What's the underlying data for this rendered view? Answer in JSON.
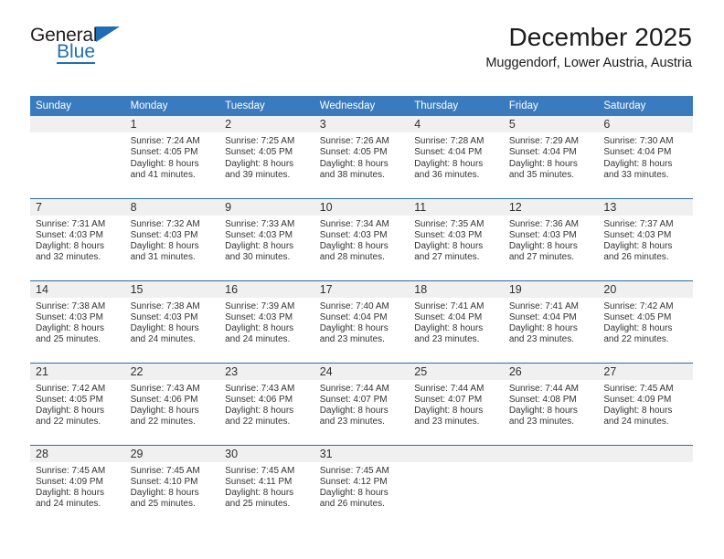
{
  "brand": {
    "name_part1": "General",
    "name_part2": "Blue",
    "triangle_color": "#1f6eb5"
  },
  "header": {
    "title": "December 2025",
    "subtitle": "Muggendorf, Lower Austria, Austria"
  },
  "colors": {
    "header_bar": "#3a7bbf",
    "row_divider": "#2e6da4",
    "daynum_band": "#f0f0f0",
    "brand_blue": "#1f6eb5"
  },
  "calendar": {
    "weekday_headers": [
      "Sunday",
      "Monday",
      "Tuesday",
      "Wednesday",
      "Thursday",
      "Friday",
      "Saturday"
    ],
    "weeks": [
      [
        {
          "day": "",
          "lines": []
        },
        {
          "day": "1",
          "lines": [
            "Sunrise: 7:24 AM",
            "Sunset: 4:05 PM",
            "Daylight: 8 hours",
            "and 41 minutes."
          ]
        },
        {
          "day": "2",
          "lines": [
            "Sunrise: 7:25 AM",
            "Sunset: 4:05 PM",
            "Daylight: 8 hours",
            "and 39 minutes."
          ]
        },
        {
          "day": "3",
          "lines": [
            "Sunrise: 7:26 AM",
            "Sunset: 4:05 PM",
            "Daylight: 8 hours",
            "and 38 minutes."
          ]
        },
        {
          "day": "4",
          "lines": [
            "Sunrise: 7:28 AM",
            "Sunset: 4:04 PM",
            "Daylight: 8 hours",
            "and 36 minutes."
          ]
        },
        {
          "day": "5",
          "lines": [
            "Sunrise: 7:29 AM",
            "Sunset: 4:04 PM",
            "Daylight: 8 hours",
            "and 35 minutes."
          ]
        },
        {
          "day": "6",
          "lines": [
            "Sunrise: 7:30 AM",
            "Sunset: 4:04 PM",
            "Daylight: 8 hours",
            "and 33 minutes."
          ]
        }
      ],
      [
        {
          "day": "7",
          "lines": [
            "Sunrise: 7:31 AM",
            "Sunset: 4:03 PM",
            "Daylight: 8 hours",
            "and 32 minutes."
          ]
        },
        {
          "day": "8",
          "lines": [
            "Sunrise: 7:32 AM",
            "Sunset: 4:03 PM",
            "Daylight: 8 hours",
            "and 31 minutes."
          ]
        },
        {
          "day": "9",
          "lines": [
            "Sunrise: 7:33 AM",
            "Sunset: 4:03 PM",
            "Daylight: 8 hours",
            "and 30 minutes."
          ]
        },
        {
          "day": "10",
          "lines": [
            "Sunrise: 7:34 AM",
            "Sunset: 4:03 PM",
            "Daylight: 8 hours",
            "and 28 minutes."
          ]
        },
        {
          "day": "11",
          "lines": [
            "Sunrise: 7:35 AM",
            "Sunset: 4:03 PM",
            "Daylight: 8 hours",
            "and 27 minutes."
          ]
        },
        {
          "day": "12",
          "lines": [
            "Sunrise: 7:36 AM",
            "Sunset: 4:03 PM",
            "Daylight: 8 hours",
            "and 27 minutes."
          ]
        },
        {
          "day": "13",
          "lines": [
            "Sunrise: 7:37 AM",
            "Sunset: 4:03 PM",
            "Daylight: 8 hours",
            "and 26 minutes."
          ]
        }
      ],
      [
        {
          "day": "14",
          "lines": [
            "Sunrise: 7:38 AM",
            "Sunset: 4:03 PM",
            "Daylight: 8 hours",
            "and 25 minutes."
          ]
        },
        {
          "day": "15",
          "lines": [
            "Sunrise: 7:38 AM",
            "Sunset: 4:03 PM",
            "Daylight: 8 hours",
            "and 24 minutes."
          ]
        },
        {
          "day": "16",
          "lines": [
            "Sunrise: 7:39 AM",
            "Sunset: 4:03 PM",
            "Daylight: 8 hours",
            "and 24 minutes."
          ]
        },
        {
          "day": "17",
          "lines": [
            "Sunrise: 7:40 AM",
            "Sunset: 4:04 PM",
            "Daylight: 8 hours",
            "and 23 minutes."
          ]
        },
        {
          "day": "18",
          "lines": [
            "Sunrise: 7:41 AM",
            "Sunset: 4:04 PM",
            "Daylight: 8 hours",
            "and 23 minutes."
          ]
        },
        {
          "day": "19",
          "lines": [
            "Sunrise: 7:41 AM",
            "Sunset: 4:04 PM",
            "Daylight: 8 hours",
            "and 23 minutes."
          ]
        },
        {
          "day": "20",
          "lines": [
            "Sunrise: 7:42 AM",
            "Sunset: 4:05 PM",
            "Daylight: 8 hours",
            "and 22 minutes."
          ]
        }
      ],
      [
        {
          "day": "21",
          "lines": [
            "Sunrise: 7:42 AM",
            "Sunset: 4:05 PM",
            "Daylight: 8 hours",
            "and 22 minutes."
          ]
        },
        {
          "day": "22",
          "lines": [
            "Sunrise: 7:43 AM",
            "Sunset: 4:06 PM",
            "Daylight: 8 hours",
            "and 22 minutes."
          ]
        },
        {
          "day": "23",
          "lines": [
            "Sunrise: 7:43 AM",
            "Sunset: 4:06 PM",
            "Daylight: 8 hours",
            "and 22 minutes."
          ]
        },
        {
          "day": "24",
          "lines": [
            "Sunrise: 7:44 AM",
            "Sunset: 4:07 PM",
            "Daylight: 8 hours",
            "and 23 minutes."
          ]
        },
        {
          "day": "25",
          "lines": [
            "Sunrise: 7:44 AM",
            "Sunset: 4:07 PM",
            "Daylight: 8 hours",
            "and 23 minutes."
          ]
        },
        {
          "day": "26",
          "lines": [
            "Sunrise: 7:44 AM",
            "Sunset: 4:08 PM",
            "Daylight: 8 hours",
            "and 23 minutes."
          ]
        },
        {
          "day": "27",
          "lines": [
            "Sunrise: 7:45 AM",
            "Sunset: 4:09 PM",
            "Daylight: 8 hours",
            "and 24 minutes."
          ]
        }
      ],
      [
        {
          "day": "28",
          "lines": [
            "Sunrise: 7:45 AM",
            "Sunset: 4:09 PM",
            "Daylight: 8 hours",
            "and 24 minutes."
          ]
        },
        {
          "day": "29",
          "lines": [
            "Sunrise: 7:45 AM",
            "Sunset: 4:10 PM",
            "Daylight: 8 hours",
            "and 25 minutes."
          ]
        },
        {
          "day": "30",
          "lines": [
            "Sunrise: 7:45 AM",
            "Sunset: 4:11 PM",
            "Daylight: 8 hours",
            "and 25 minutes."
          ]
        },
        {
          "day": "31",
          "lines": [
            "Sunrise: 7:45 AM",
            "Sunset: 4:12 PM",
            "Daylight: 8 hours",
            "and 26 minutes."
          ]
        },
        {
          "day": "",
          "lines": []
        },
        {
          "day": "",
          "lines": []
        },
        {
          "day": "",
          "lines": []
        }
      ]
    ]
  }
}
